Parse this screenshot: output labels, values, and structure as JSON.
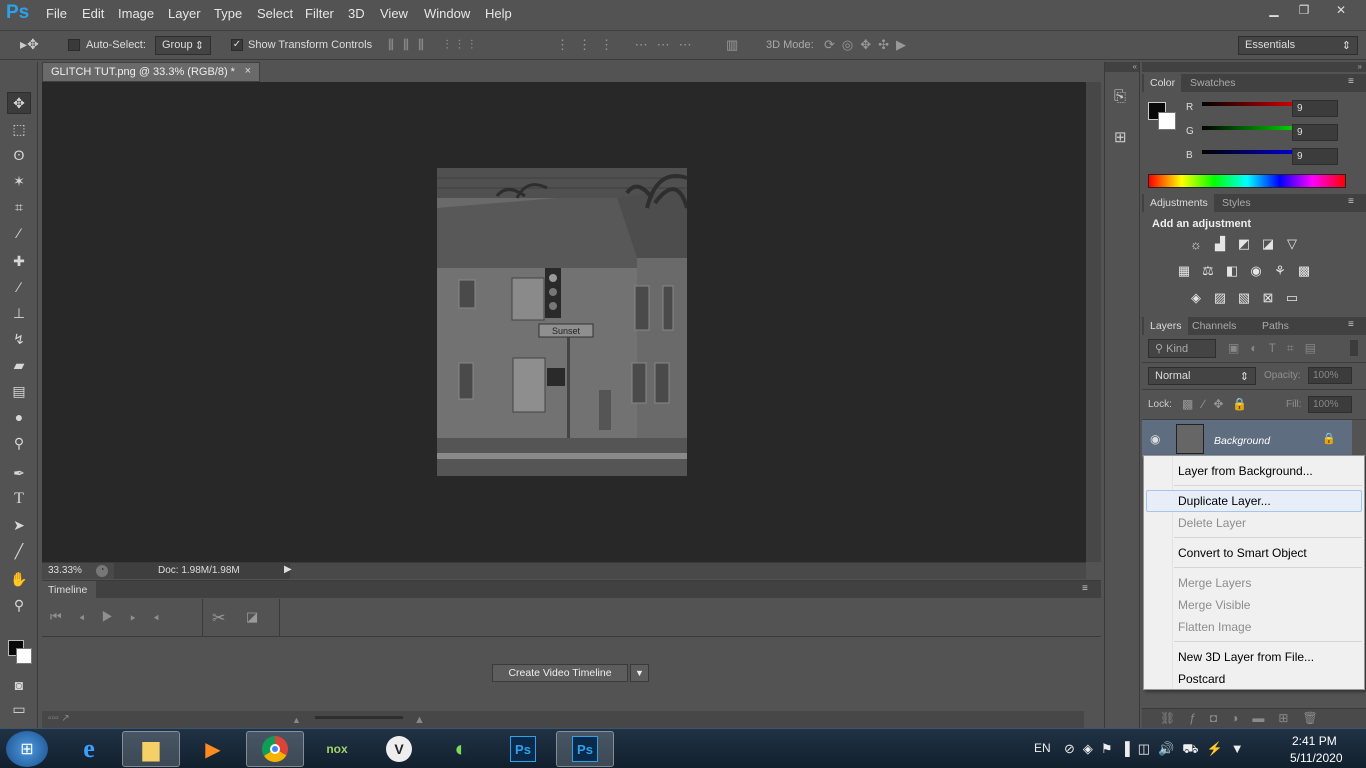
{
  "app": {
    "logo": "Ps"
  },
  "menubar": {
    "items": [
      "File",
      "Edit",
      "Image",
      "Layer",
      "Type",
      "Select",
      "Filter",
      "3D",
      "View",
      "Window",
      "Help"
    ]
  },
  "window_controls": {
    "minimize": "▁",
    "restore": "❐",
    "close": "✕"
  },
  "options_bar": {
    "auto_select_label": "Auto-Select:",
    "auto_select_checked": false,
    "auto_select_value": "Group",
    "show_transform_label": "Show Transform Controls",
    "show_transform_checked": true,
    "mode_3d_label": "3D Mode:",
    "workspace": "Essentials"
  },
  "document": {
    "tab_title": "GLITCH TUT.png @ 33.3% (RGB/8) *",
    "zoom": "33.33%",
    "doc_size": "Doc: 1.98M/1.98M",
    "image_sign_text": "Sunset"
  },
  "timeline": {
    "title": "Timeline",
    "create_button": "Create Video Timeline"
  },
  "color_panel": {
    "tabs": [
      "Color",
      "Swatches"
    ],
    "r_label": "R",
    "r_value": "9",
    "g_label": "G",
    "g_value": "9",
    "b_label": "B",
    "b_value": "9",
    "colors": {
      "foreground": "#090909",
      "background": "#ffffff"
    }
  },
  "adjustments_panel": {
    "tabs": [
      "Adjustments",
      "Styles"
    ],
    "heading": "Add an adjustment"
  },
  "layers_panel": {
    "tabs": [
      "Layers",
      "Channels",
      "Paths"
    ],
    "filter_kind": "Kind",
    "blend_mode": "Normal",
    "opacity_label": "Opacity:",
    "opacity_value": "100%",
    "lock_label": "Lock:",
    "fill_label": "Fill:",
    "fill_value": "100%",
    "layer_name": "Background"
  },
  "context_menu": {
    "items": [
      {
        "label": "Layer from Background...",
        "disabled": false
      },
      {
        "label": "Duplicate Layer...",
        "disabled": false,
        "highlighted": true
      },
      {
        "label": "Delete Layer",
        "disabled": true
      },
      {
        "label": "Convert to Smart Object",
        "disabled": false
      },
      {
        "label": "Merge Layers",
        "disabled": true
      },
      {
        "label": "Merge Visible",
        "disabled": true
      },
      {
        "label": "Flatten Image",
        "disabled": true
      },
      {
        "label": "New 3D Layer from File...",
        "disabled": false
      },
      {
        "label": "Postcard",
        "disabled": false
      }
    ]
  },
  "taskbar": {
    "language": "EN",
    "time": "2:41 PM",
    "date": "5/11/2020",
    "apps": [
      "windows-explorer",
      "internet-explorer",
      "file-explorer",
      "media-player",
      "chrome",
      "nox",
      "vectr",
      "green-app",
      "photoshop-admin",
      "photoshop"
    ]
  }
}
